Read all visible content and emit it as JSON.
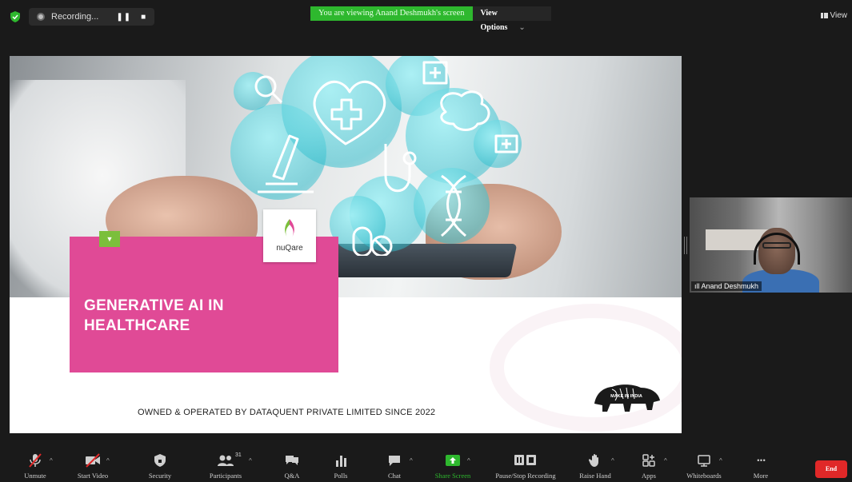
{
  "top_bar": {
    "recording_label": "Recording...",
    "pause_glyph": "❚❚",
    "stop_glyph": "■",
    "viewing_banner": "You are viewing Anand Deshmukh's screen",
    "view_options_label": "View Options",
    "view_options_chevron": "⌄",
    "view_label": "View"
  },
  "slide": {
    "title": "GENERATIVE AI IN HEALTHCARE",
    "logo_text": "nuQare",
    "footer": "OWNED & OPERATED BY DATAQUENT PRIVATE LIMITED SINCE 2022",
    "lion_text": "MAKE IN INDIA",
    "chip_glyph": "▼",
    "accent_pink": "#e04a96",
    "accent_green": "#7bbf3b"
  },
  "participant": {
    "name": "Anand Deshmukh",
    "signal_glyph": "ıll"
  },
  "toolbar": {
    "items": [
      {
        "label": "Unmute",
        "icon": "mic-muted-icon"
      },
      {
        "label": "Start Video",
        "icon": "video-off-icon"
      },
      {
        "label": "Security",
        "icon": "shield-icon"
      },
      {
        "label": "Participants",
        "icon": "participants-icon",
        "count": "31"
      },
      {
        "label": "Q&A",
        "icon": "qa-icon"
      },
      {
        "label": "Polls",
        "icon": "polls-icon"
      },
      {
        "label": "Chat",
        "icon": "chat-icon"
      },
      {
        "label": "Share Screen",
        "icon": "share-screen-icon"
      },
      {
        "label": "Pause/Stop Recording",
        "icon": "pause-stop-recording-icon"
      },
      {
        "label": "Raise Hand",
        "icon": "raise-hand-icon"
      },
      {
        "label": "Apps",
        "icon": "apps-icon"
      },
      {
        "label": "Whiteboards",
        "icon": "whiteboard-icon"
      },
      {
        "label": "More",
        "icon": "more-icon"
      }
    ],
    "end_label": "End",
    "caret_glyph": "^",
    "more_glyph": "• • •"
  }
}
